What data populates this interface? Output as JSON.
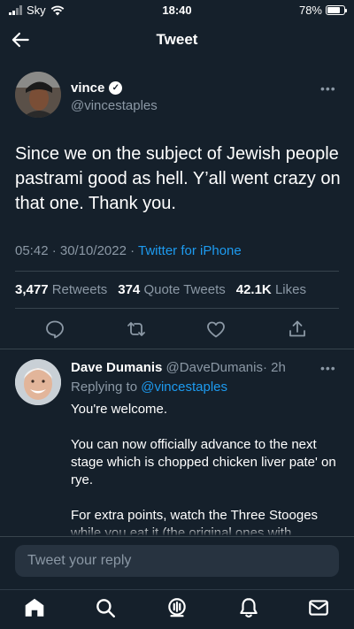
{
  "status_bar": {
    "carrier": "Sky",
    "time": "18:40",
    "battery": "78%",
    "battery_level": 0.78
  },
  "header": {
    "title": "Tweet"
  },
  "tweet": {
    "author_name": "vince",
    "author_handle": "@vincestaples",
    "text": "Since we on the subject of Jewish people pastrami good as hell.  Y’all went crazy on that one. Thank you.",
    "time": "05:42 · 30/10/2022 · ",
    "source": "Twitter for iPhone",
    "stats": {
      "retweets_count": "3,477",
      "retweets_label": "Retweets",
      "quotes_count": "374",
      "quotes_label": "Quote Tweets",
      "likes_count": "42.1K",
      "likes_label": "Likes"
    }
  },
  "reply": {
    "author_name": "Dave Dumanis",
    "author_handle": "@DaveDumanis",
    "time": "· 2h",
    "replying_prefix": "Replying to ",
    "replying_to": "@vincestaples",
    "paragraphs": [
      "You're welcome.",
      "You can now officially advance to the next stage which is chopped chicken liver pate' on rye.",
      "For extra points, watch the Three Stooges while you eat it (the original ones with"
    ]
  },
  "composer": {
    "placeholder": "Tweet your reply"
  },
  "icons": {
    "back": "arrow-left-icon",
    "more": "ellipsis-icon",
    "actions": [
      "reply-icon",
      "retweet-icon",
      "like-icon",
      "share-icon"
    ],
    "tabs": [
      "home-icon",
      "search-icon",
      "spaces-icon",
      "notifications-icon",
      "messages-icon"
    ]
  },
  "colors": {
    "background": "#15202b",
    "accent": "#1d9bf0",
    "secondary_text": "#8b98a5",
    "divider": "#38444d"
  }
}
